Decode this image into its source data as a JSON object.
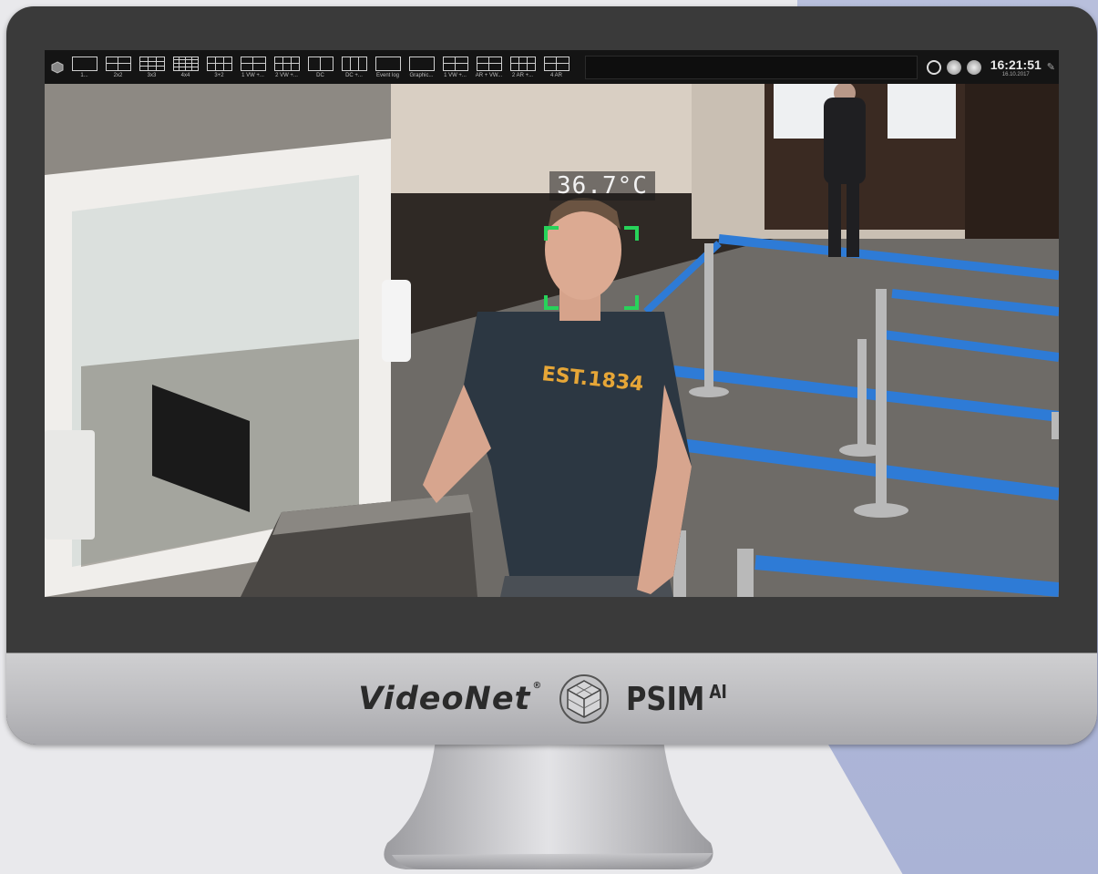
{
  "toolbar": {
    "layouts": [
      {
        "label": "1...",
        "cols": 1,
        "rows": 1
      },
      {
        "label": "2x2",
        "cols": 2,
        "rows": 2
      },
      {
        "label": "3x3",
        "cols": 3,
        "rows": 3
      },
      {
        "label": "4x4",
        "cols": 4,
        "rows": 4
      },
      {
        "label": "3+2",
        "cols": 3,
        "rows": 2
      },
      {
        "label": "1 VW +...",
        "cols": 2,
        "rows": 2
      },
      {
        "label": "2 VW +...",
        "cols": 3,
        "rows": 2
      },
      {
        "label": "DC",
        "cols": 2,
        "rows": 1
      },
      {
        "label": "DC +...",
        "cols": 3,
        "rows": 1
      },
      {
        "label": "Event log",
        "cols": 1,
        "rows": 1
      },
      {
        "label": "Graphic...",
        "cols": 1,
        "rows": 1
      },
      {
        "label": "1 VW +...",
        "cols": 2,
        "rows": 2
      },
      {
        "label": "AR + VW...",
        "cols": 2,
        "rows": 2
      },
      {
        "label": "2 AR +...",
        "cols": 3,
        "rows": 2
      },
      {
        "label": "4 AR",
        "cols": 2,
        "rows": 2
      }
    ],
    "clock_time": "16:21:51",
    "clock_date": "16.10.2017"
  },
  "feed": {
    "temperature": "36.7°C",
    "shirt_text": "EST.1834"
  },
  "branding": {
    "videonet": "VideoNet",
    "psim": "PSIM",
    "ai": "AI",
    "reg": "®"
  }
}
